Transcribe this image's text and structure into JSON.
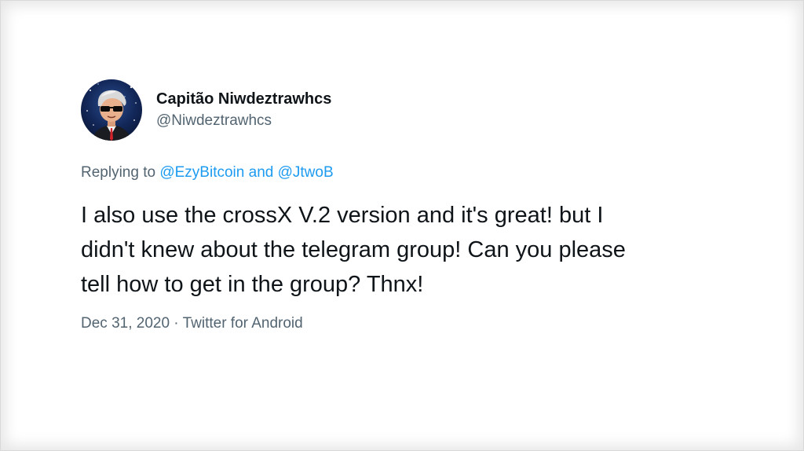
{
  "author": {
    "display_name": "Capitão Niwdeztrawhcs",
    "handle": "@Niwdeztrawhcs"
  },
  "reply": {
    "prefix": "Replying to ",
    "mentions": [
      "@EzyBitcoin",
      "@JtwoB"
    ],
    "conjunction": " and "
  },
  "tweet": {
    "lines": [
      "I also use the crossX V.2 version and it's great! but I",
      "didn't knew about the telegram group! Can you please",
      "tell how to get in the group? Thnx!"
    ]
  },
  "meta": {
    "date": "Dec 31, 2020",
    "separator": " · ",
    "source": "Twitter for Android"
  },
  "colors": {
    "text": "#0f1419",
    "secondary": "#536471",
    "link": "#1d9bf0"
  },
  "icons": {
    "avatar": "cartoon-person-sunglasses-avatar"
  }
}
